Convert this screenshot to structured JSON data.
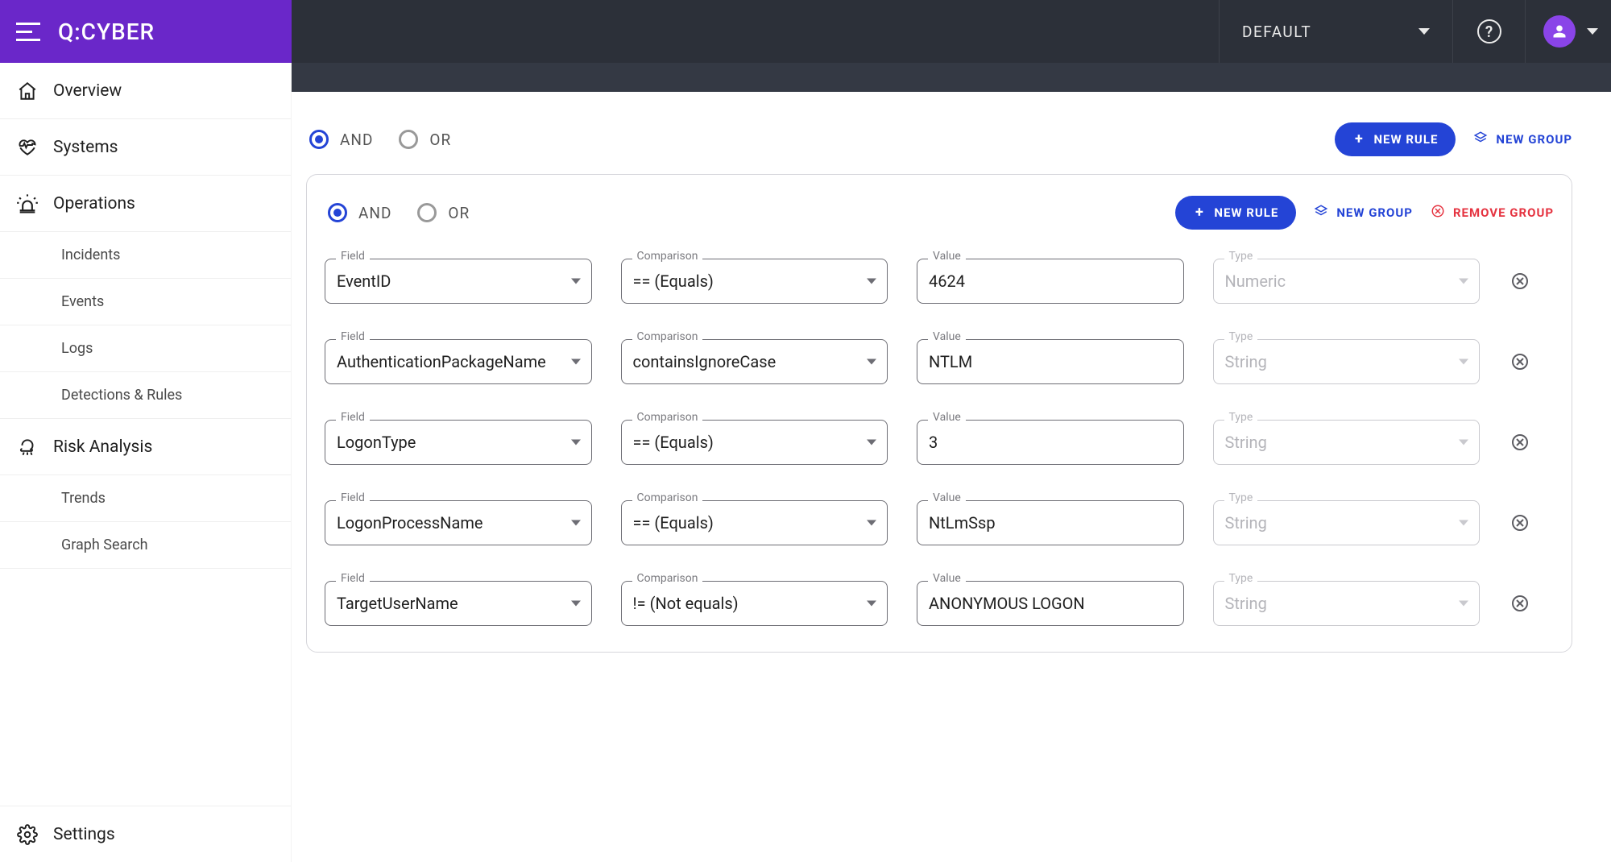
{
  "header": {
    "logo": "Q:CYBER",
    "tenant": "DEFAULT"
  },
  "sidebar": {
    "overview": "Overview",
    "systems": "Systems",
    "operations": "Operations",
    "incidents": "Incidents",
    "events": "Events",
    "logs": "Logs",
    "detections": "Detections & Rules",
    "risk_analysis": "Risk Analysis",
    "trends": "Trends",
    "graph_search": "Graph Search",
    "settings": "Settings"
  },
  "labels": {
    "and": "AND",
    "or": "OR",
    "new_rule": "NEW RULE",
    "new_group": "NEW GROUP",
    "remove_group": "REMOVE GROUP",
    "field": "Field",
    "comparison": "Comparison",
    "value": "Value",
    "type": "Type"
  },
  "outer_group": {
    "operator": "AND"
  },
  "inner_group": {
    "operator": "AND",
    "rules": [
      {
        "field": "EventID",
        "comparison": "== (Equals)",
        "value": "4624",
        "type": "Numeric"
      },
      {
        "field": "AuthenticationPackageName",
        "comparison": "containsIgnoreCase",
        "value": "NTLM",
        "type": "String"
      },
      {
        "field": "LogonType",
        "comparison": "== (Equals)",
        "value": "3",
        "type": "String"
      },
      {
        "field": "LogonProcessName",
        "comparison": "== (Equals)",
        "value": "NtLmSsp",
        "type": "String"
      },
      {
        "field": "TargetUserName",
        "comparison": "!= (Not equals)",
        "value": "ANONYMOUS LOGON",
        "type": "String"
      }
    ]
  }
}
